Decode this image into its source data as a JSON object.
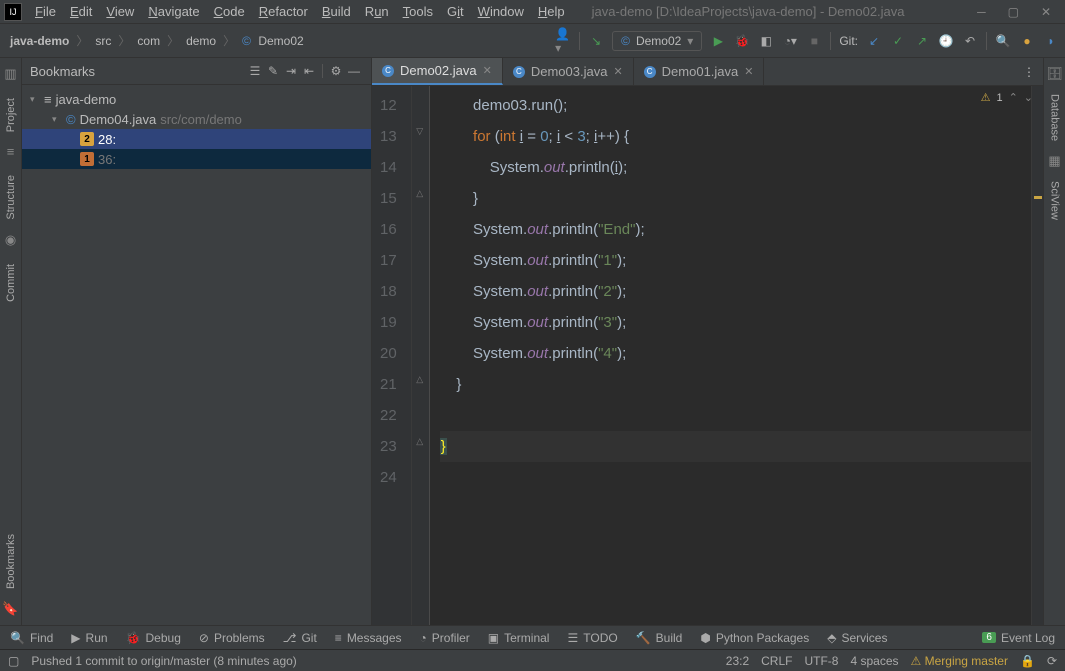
{
  "window": {
    "title": "java-demo [D:\\IdeaProjects\\java-demo] - Demo02.java"
  },
  "menu": [
    "File",
    "Edit",
    "View",
    "Navigate",
    "Code",
    "Refactor",
    "Build",
    "Run",
    "Tools",
    "Git",
    "Window",
    "Help"
  ],
  "breadcrumb": [
    "java-demo",
    "src",
    "com",
    "demo",
    "Demo02"
  ],
  "run_config": "Demo02",
  "git_label": "Git:",
  "left_tabs": {
    "project": "Project",
    "structure": "Structure",
    "commit": "Commit",
    "bookmarks": "Bookmarks"
  },
  "right_tabs": {
    "database": "Database",
    "sciview": "SciView"
  },
  "bookmarks": {
    "title": "Bookmarks",
    "root": "java-demo",
    "file": "Demo04.java",
    "file_path": "src/com/demo",
    "items": [
      {
        "badge": "2",
        "label": "28:"
      },
      {
        "badge": "1",
        "label": "36:"
      }
    ]
  },
  "tabs": [
    {
      "name": "Demo02.java",
      "active": true
    },
    {
      "name": "Demo03.java",
      "active": false
    },
    {
      "name": "Demo01.java",
      "active": false
    }
  ],
  "inspection": {
    "warn_count": "1"
  },
  "code": {
    "lines": [
      {
        "n": 12,
        "html": "        demo03.run();"
      },
      {
        "n": 13,
        "html": "        <kw>for</kw> (<ty>int</ty> <uvar>i</uvar> = <num>0</num>; <uvar>i</uvar> &lt; <num>3</num>; <uvar>i</uvar>++) {"
      },
      {
        "n": 14,
        "html": "            System.<mem>out</mem>.println(<uvar>i</uvar>);"
      },
      {
        "n": 15,
        "html": "        }"
      },
      {
        "n": 16,
        "html": "        System.<mem>out</mem>.println(<str>\"End\"</str>);"
      },
      {
        "n": 17,
        "html": "        System.<mem>out</mem>.println(<str>\"1\"</str>);"
      },
      {
        "n": 18,
        "html": "        System.<mem>out</mem>.println(<str>\"2\"</str>);"
      },
      {
        "n": 19,
        "html": "        System.<mem>out</mem>.println(<str>\"3\"</str>);"
      },
      {
        "n": 20,
        "html": "        System.<mem>out</mem>.println(<str>\"4\"</str>);"
      },
      {
        "n": 21,
        "html": "    }"
      },
      {
        "n": 22,
        "html": ""
      },
      {
        "n": 23,
        "html": "<brace>}</brace>",
        "current": true
      },
      {
        "n": 24,
        "html": ""
      }
    ]
  },
  "bottom_tools": {
    "find": "Find",
    "run": "Run",
    "debug": "Debug",
    "problems": "Problems",
    "git": "Git",
    "messages": "Messages",
    "profiler": "Profiler",
    "terminal": "Terminal",
    "todo": "TODO",
    "build": "Build",
    "python": "Python Packages",
    "services": "Services",
    "event_log": "Event Log",
    "event_count": "6"
  },
  "status": {
    "push_msg": "Pushed 1 commit to origin/master (8 minutes ago)",
    "pos": "23:2",
    "eol": "CRLF",
    "enc": "UTF-8",
    "indent": "4 spaces",
    "branch": "Merging master"
  }
}
